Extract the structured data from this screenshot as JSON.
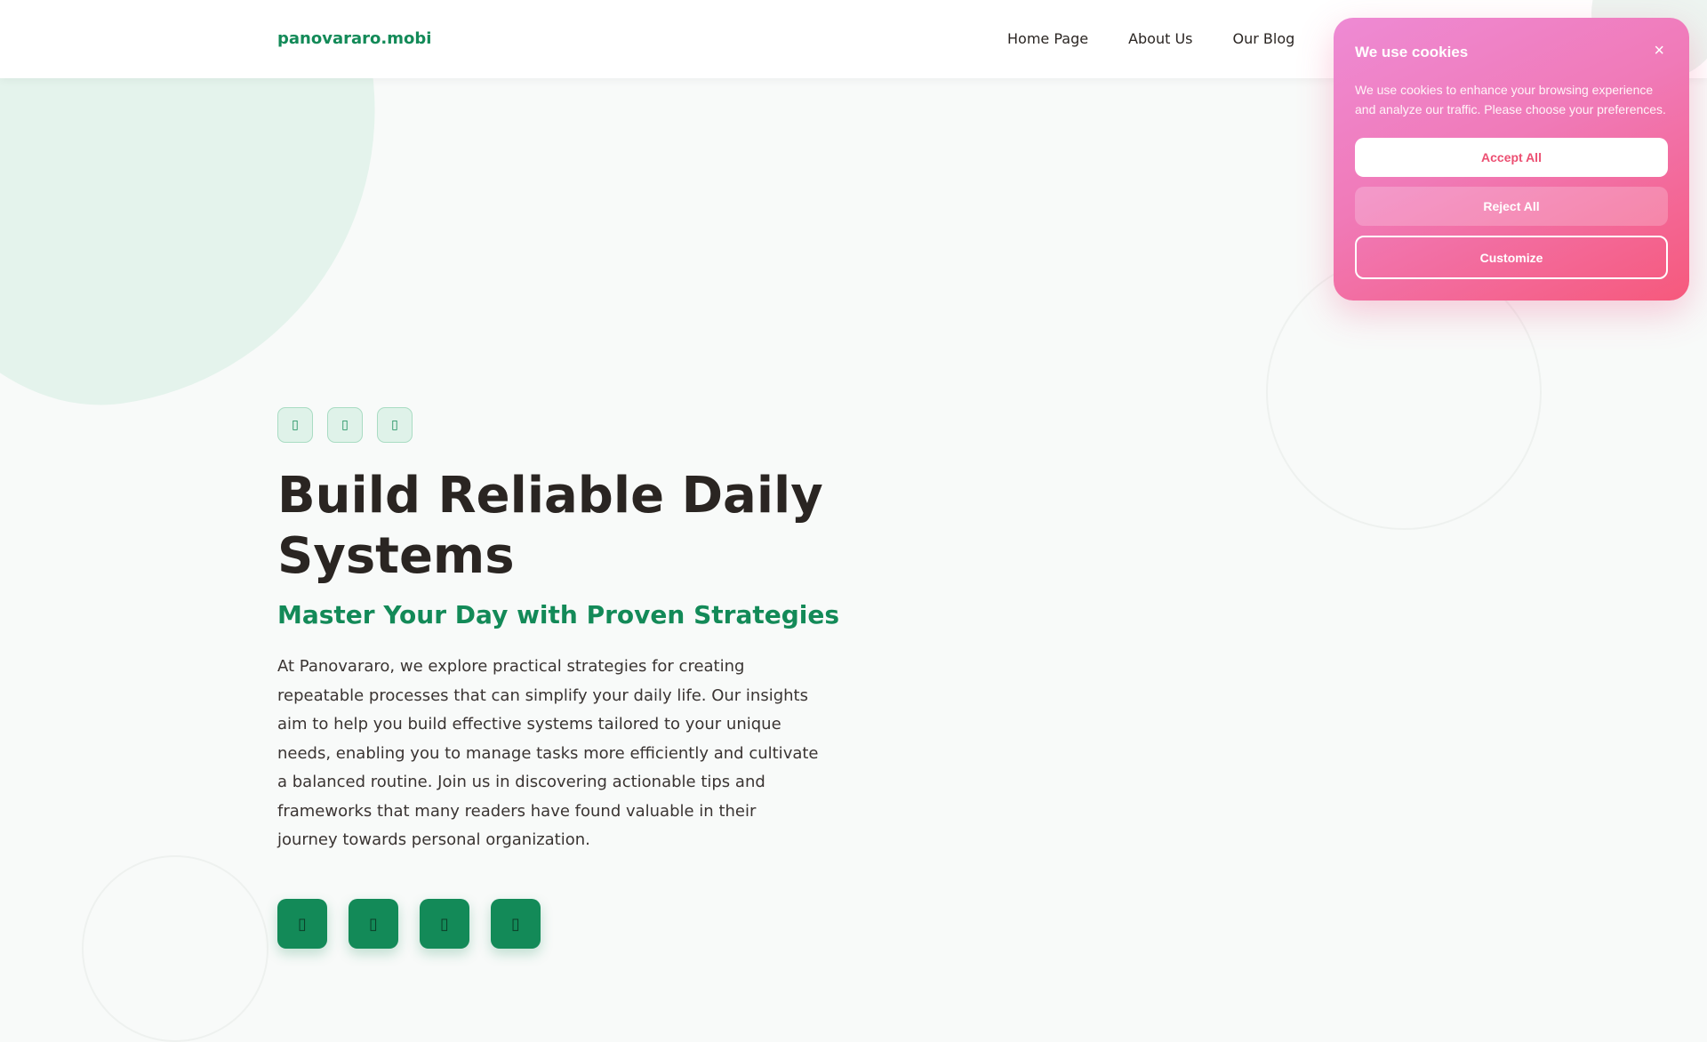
{
  "header": {
    "logo": "panovararo.mobi",
    "nav": [
      "Home Page",
      "About Us",
      "Our Blog"
    ]
  },
  "hero": {
    "tag_icons": [
      "tag-icon-1",
      "tag-icon-2",
      "tag-icon-3"
    ],
    "title": "Build Reliable Daily Systems",
    "subtitle": "Master Your Day with Proven Strategies",
    "description": "At Panovararo, we explore practical strategies for creating repeatable processes that can simplify your daily life. Our insights aim to help you build effective systems tailored to your unique needs, enabling you to manage tasks more efficiently and cultivate a balanced routine. Join us in discovering actionable tips and frameworks that many readers have found valuable in their journey towards personal organization."
  },
  "social_icons": [
    "social-icon-1",
    "social-icon-2",
    "social-icon-3",
    "social-icon-4"
  ],
  "cookie": {
    "title": "We use cookies",
    "close_glyph": "×",
    "text": "We use cookies to enhance your browsing experience and analyze our traffic. Please choose your preferences.",
    "accept_label": "Accept All",
    "reject_label": "Reject All",
    "customize_label": "Customize"
  },
  "colors": {
    "brand_green": "#138a58",
    "cookie_gradient_start": "#ee8ad4",
    "cookie_gradient_end": "#f6597c",
    "accept_text": "#ec4f72"
  }
}
